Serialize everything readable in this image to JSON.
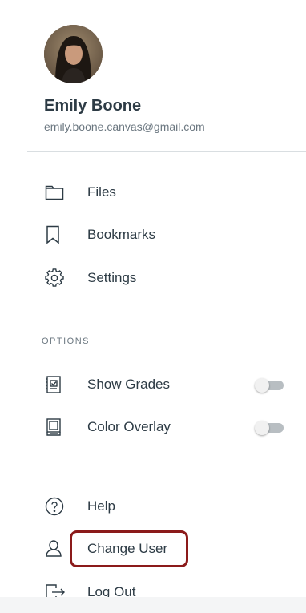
{
  "profile": {
    "name": "Emily Boone",
    "email": "emily.boone.canvas@gmail.com"
  },
  "menu": [
    {
      "label": "Files",
      "icon": "folder-icon"
    },
    {
      "label": "Bookmarks",
      "icon": "bookmark-icon"
    },
    {
      "label": "Settings",
      "icon": "gear-icon"
    }
  ],
  "options": {
    "title": "OPTIONS",
    "items": [
      {
        "label": "Show Grades",
        "icon": "grades-icon",
        "enabled": false
      },
      {
        "label": "Color Overlay",
        "icon": "overlay-icon",
        "enabled": false
      }
    ]
  },
  "footer": [
    {
      "label": "Help",
      "icon": "help-icon"
    },
    {
      "label": "Change User",
      "icon": "user-icon"
    },
    {
      "label": "Log Out",
      "icon": "logout-icon"
    }
  ],
  "colors": {
    "text": "#2d3b45",
    "muted": "#6b7780",
    "highlight": "#8b1a1a"
  }
}
